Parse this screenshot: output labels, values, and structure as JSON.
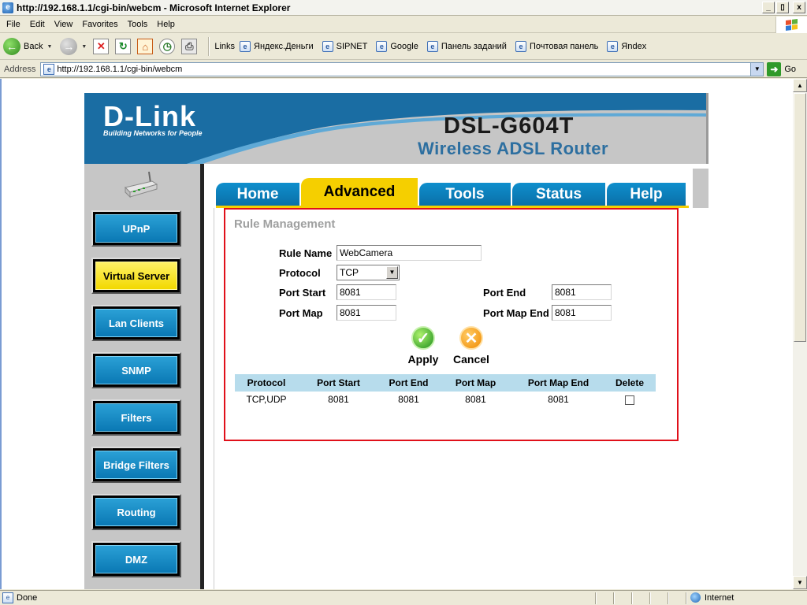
{
  "window": {
    "title": "http://192.168.1.1/cgi-bin/webcm - Microsoft Internet Explorer",
    "buttons": {
      "minimize": "_",
      "restore": "▯",
      "close": "x"
    }
  },
  "menu": [
    "File",
    "Edit",
    "View",
    "Favorites",
    "Tools",
    "Help"
  ],
  "toolbar": {
    "back_label": "Back",
    "links_label": "Links",
    "links": [
      "Яндекс.Деньги",
      "SIPNET",
      "Google",
      "Панель заданий",
      "Почтовая панель",
      "Яndex"
    ]
  },
  "address": {
    "label": "Address",
    "url": "http://192.168.1.1/cgi-bin/webcm",
    "go_label": "Go"
  },
  "status": {
    "text": "Done",
    "zone": "Internet"
  },
  "header": {
    "logo": "D-Link",
    "tagline": "Building Networks for People",
    "model": "DSL-G604T",
    "product": "Wireless ADSL Router"
  },
  "sidebar": {
    "items": [
      {
        "label": "UPnP",
        "active": false
      },
      {
        "label": "Virtual Server",
        "active": true
      },
      {
        "label": "Lan Clients",
        "active": false
      },
      {
        "label": "SNMP",
        "active": false
      },
      {
        "label": "Filters",
        "active": false
      },
      {
        "label": "Bridge Filters",
        "active": false
      },
      {
        "label": "Routing",
        "active": false
      },
      {
        "label": "DMZ",
        "active": false
      }
    ]
  },
  "tabs": [
    {
      "label": "Home",
      "active": false
    },
    {
      "label": "Advanced",
      "active": true
    },
    {
      "label": "Tools",
      "active": false
    },
    {
      "label": "Status",
      "active": false
    },
    {
      "label": "Help",
      "active": false
    }
  ],
  "rule_management": {
    "title": "Rule Management",
    "fields": {
      "rule_name": {
        "label": "Rule Name",
        "value": "WebCamera"
      },
      "protocol": {
        "label": "Protocol",
        "value": "TCP"
      },
      "port_start": {
        "label": "Port Start",
        "value": "8081"
      },
      "port_end": {
        "label": "Port End",
        "value": "8081"
      },
      "port_map": {
        "label": "Port Map",
        "value": "8081"
      },
      "port_map_end": {
        "label": "Port Map End",
        "value": "8081"
      }
    },
    "apply_label": "Apply",
    "cancel_label": "Cancel",
    "table": {
      "headers": [
        "Protocol",
        "Port Start",
        "Port End",
        "Port Map",
        "Port Map End",
        "Delete"
      ],
      "rows": [
        {
          "protocol": "TCP,UDP",
          "port_start": "8081",
          "port_end": "8081",
          "port_map": "8081",
          "port_map_end": "8081",
          "delete": false
        }
      ]
    }
  },
  "colors": {
    "accent_blue": "#0a78b4",
    "active_yellow": "#f5cf00",
    "frame_red": "#e0101a",
    "table_header": "#b7dcec"
  }
}
